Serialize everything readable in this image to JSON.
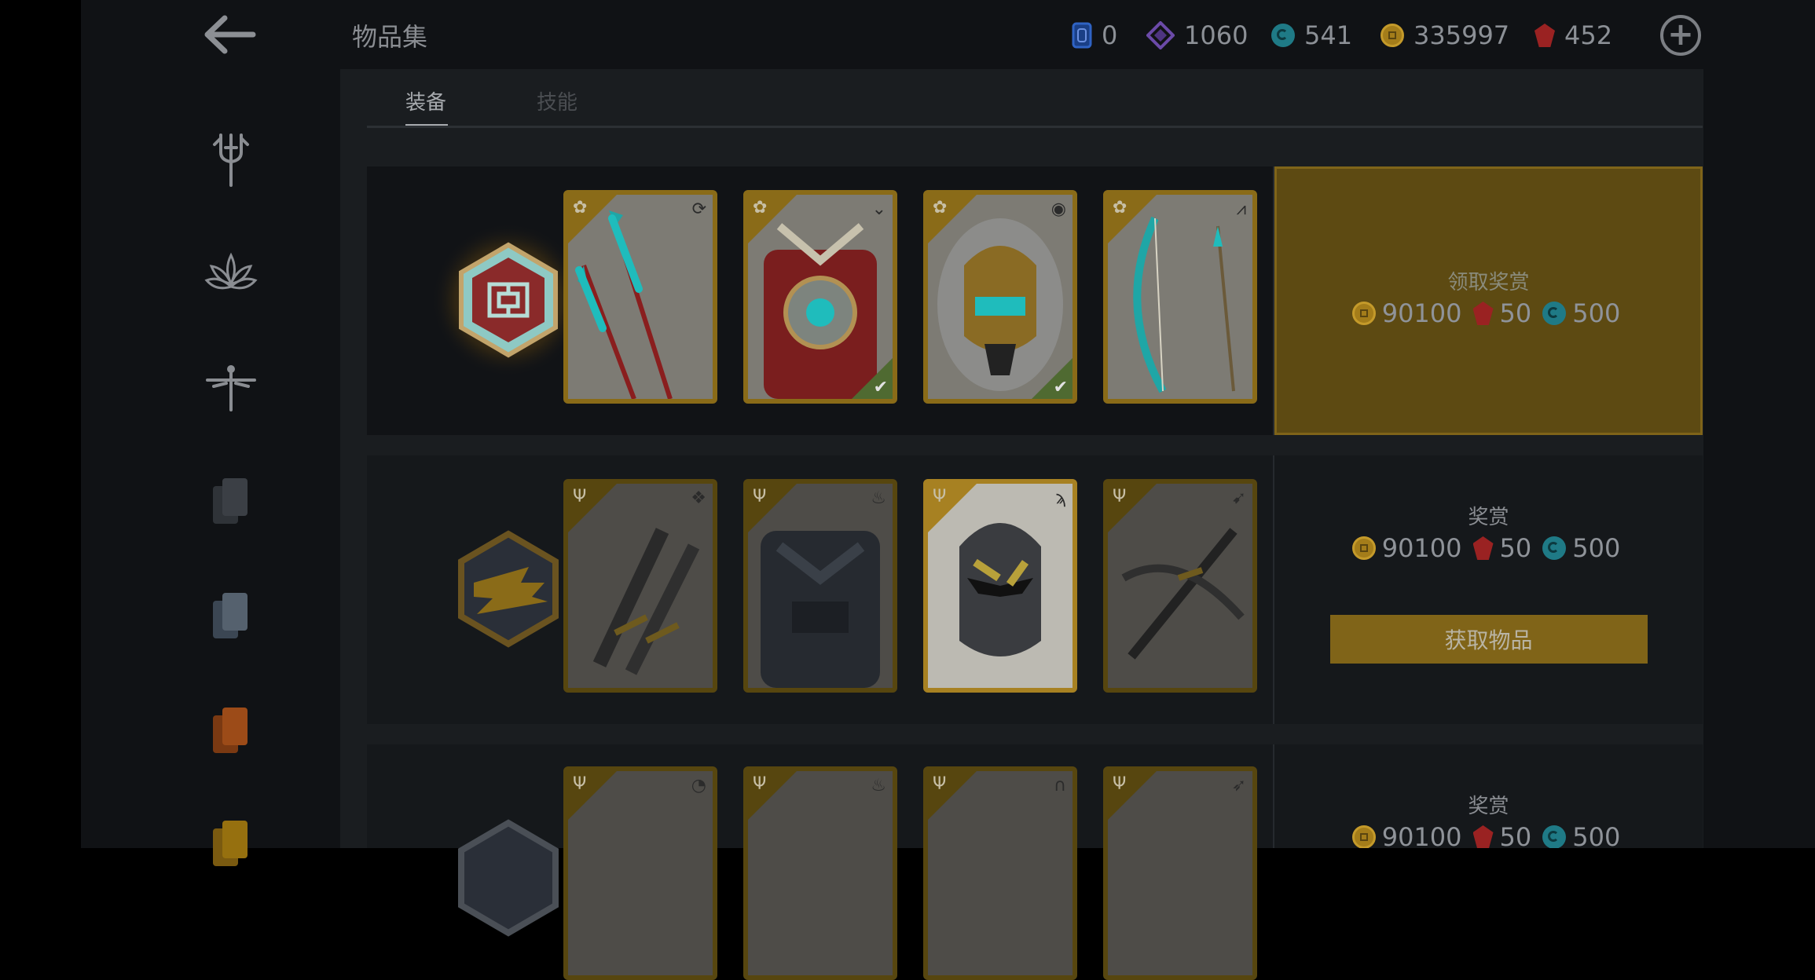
{
  "header": {
    "title": "物品集",
    "back_icon": "back-arrow-icon",
    "add_icon": "add-circle-icon"
  },
  "currencies": [
    {
      "icon": "ticket-icon",
      "value": "0",
      "color": "#1f4fa0"
    },
    {
      "icon": "purple-diamond-icon",
      "value": "1060",
      "color": "#6b4aa8"
    },
    {
      "icon": "teal-swirl-icon",
      "value": "541",
      "color": "#1f7a86"
    },
    {
      "icon": "gold-coin-icon",
      "value": "335997",
      "color": "#a47d1a"
    },
    {
      "icon": "ruby-icon",
      "value": "452",
      "color": "#9a2222"
    }
  ],
  "sidebar": {
    "items": [
      {
        "icon": "trident-icon"
      },
      {
        "icon": "lotus-icon"
      },
      {
        "icon": "dragonfly-icon"
      },
      {
        "icon": "cards-gray-icon"
      },
      {
        "icon": "cards-slate-icon"
      },
      {
        "icon": "cards-orange-icon"
      },
      {
        "icon": "cards-gold-icon"
      }
    ]
  },
  "tabs": [
    {
      "label": "装备",
      "active": true
    },
    {
      "label": "技能",
      "active": false
    }
  ],
  "sets": [
    {
      "emblem": "maze-hexagon-emblem",
      "items": [
        {
          "name": "twin-spears",
          "corner_icon": "lotus-icon",
          "type_icon": "cycle-icon",
          "owned": false
        },
        {
          "name": "armor",
          "corner_icon": "lotus-icon",
          "type_icon": "chevron-icon",
          "owned": true
        },
        {
          "name": "helmet",
          "corner_icon": "lotus-icon",
          "type_icon": "eye-icon",
          "owned": true
        },
        {
          "name": "bow",
          "corner_icon": "lotus-icon",
          "type_icon": "arrows-icon",
          "owned": false
        }
      ],
      "reward": {
        "title": "领取奖赏",
        "coins": "90100",
        "rubies": "50",
        "swirls": "500",
        "claimable": true
      }
    },
    {
      "emblem": "gold-slash-hexagon-emblem",
      "items": [
        {
          "name": "swords",
          "corner_icon": "trident-icon",
          "type_icon": "diamond-icon",
          "owned": false
        },
        {
          "name": "armor",
          "corner_icon": "trident-icon",
          "type_icon": "flame-icon",
          "owned": false
        },
        {
          "name": "helmet",
          "corner_icon": "trident-icon",
          "type_icon": "tail-icon",
          "owned": false
        },
        {
          "name": "crossbow",
          "corner_icon": "trident-icon",
          "type_icon": "swoosh-icon",
          "owned": false
        }
      ],
      "reward": {
        "title": "奖赏",
        "coins": "90100",
        "rubies": "50",
        "swirls": "500",
        "button_label": "获取物品"
      }
    },
    {
      "emblem": "hexagon-emblem",
      "items": [
        {
          "name": "item",
          "corner_icon": "trident-icon",
          "type_icon": "orb-icon",
          "owned": false
        },
        {
          "name": "item",
          "corner_icon": "trident-icon",
          "type_icon": "flame-icon",
          "owned": false
        },
        {
          "name": "item",
          "corner_icon": "trident-icon",
          "type_icon": "arc-icon",
          "owned": false
        },
        {
          "name": "item",
          "corner_icon": "trident-icon",
          "type_icon": "wing-icon",
          "owned": false
        }
      ],
      "reward": {
        "title": "奖赏",
        "coins": "90100",
        "rubies": "50",
        "swirls": "500"
      }
    }
  ]
}
